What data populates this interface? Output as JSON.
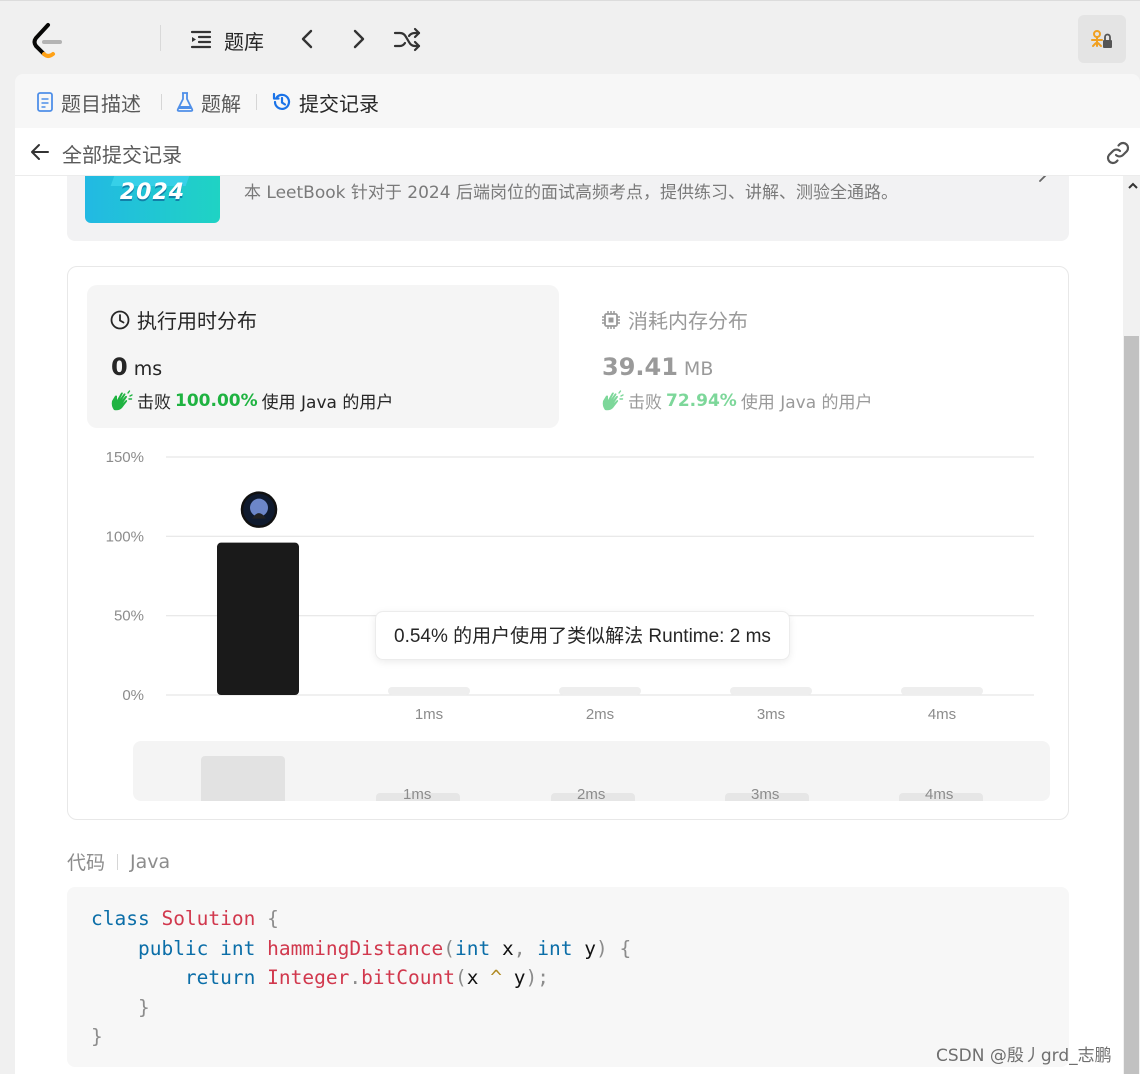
{
  "topnav": {
    "problem_list_label": "题库",
    "icons": [
      "leetcode-logo",
      "list-icon",
      "chevron-left-icon",
      "chevron-right-icon",
      "shuffle-icon",
      "debug-lock-icon"
    ]
  },
  "tabs": [
    {
      "label": "题目描述",
      "icon": "document-icon",
      "active": false
    },
    {
      "label": "题解",
      "icon": "flask-icon",
      "active": false
    },
    {
      "label": "提交记录",
      "icon": "history-icon",
      "active": true
    }
  ],
  "header": {
    "title": "全部提交记录"
  },
  "banner": {
    "image_text": "2024",
    "text": "本 LeetBook 针对于 2024 后端岗位的面试高频考点，提供练习、讲解、测验全通路。"
  },
  "runtime": {
    "title": "执行用时分布",
    "value": "0",
    "unit": "ms",
    "beat_prefix": "击败",
    "beat_percent": "100.00%",
    "beat_suffix": "使用 Java 的用户"
  },
  "memory": {
    "title": "消耗内存分布",
    "value": "39.41",
    "unit": "MB",
    "beat_prefix": "击败",
    "beat_percent": "72.94%",
    "beat_suffix": "使用 Java 的用户"
  },
  "chart_data": {
    "type": "bar",
    "categories": [
      "0ms",
      "1ms",
      "2ms",
      "3ms",
      "4ms"
    ],
    "tick_labels": [
      "",
      "1ms",
      "2ms",
      "3ms",
      "4ms"
    ],
    "values": [
      96,
      0.5,
      0.54,
      0.5,
      0.5
    ],
    "y_ticks": [
      "150%",
      "100%",
      "50%",
      "0%"
    ],
    "ylim": [
      0,
      150
    ],
    "grid": true,
    "highlight_index": 0,
    "bar_color_highlight": "#1a1a1a",
    "bar_color": "#eeeeee"
  },
  "tooltip": {
    "text": "0.54% 的用户使用了类似解法 Runtime: 2 ms"
  },
  "minimap": {
    "labels": [
      "1ms",
      "2ms",
      "3ms",
      "4ms"
    ]
  },
  "code": {
    "label": "代码",
    "language": "Java",
    "lines": [
      "class Solution {",
      "    public int hammingDistance(int x, int y) {",
      "        return Integer.bitCount(x ^ y);",
      "    }",
      "}"
    ]
  },
  "watermark": "CSDN @殷丿grd_志鹏",
  "colors": {
    "accent_green": "#1fb341",
    "tab_active_icon": "#1a73e8",
    "keyword": "#0b6ea8",
    "class_name": "#d1384d"
  }
}
